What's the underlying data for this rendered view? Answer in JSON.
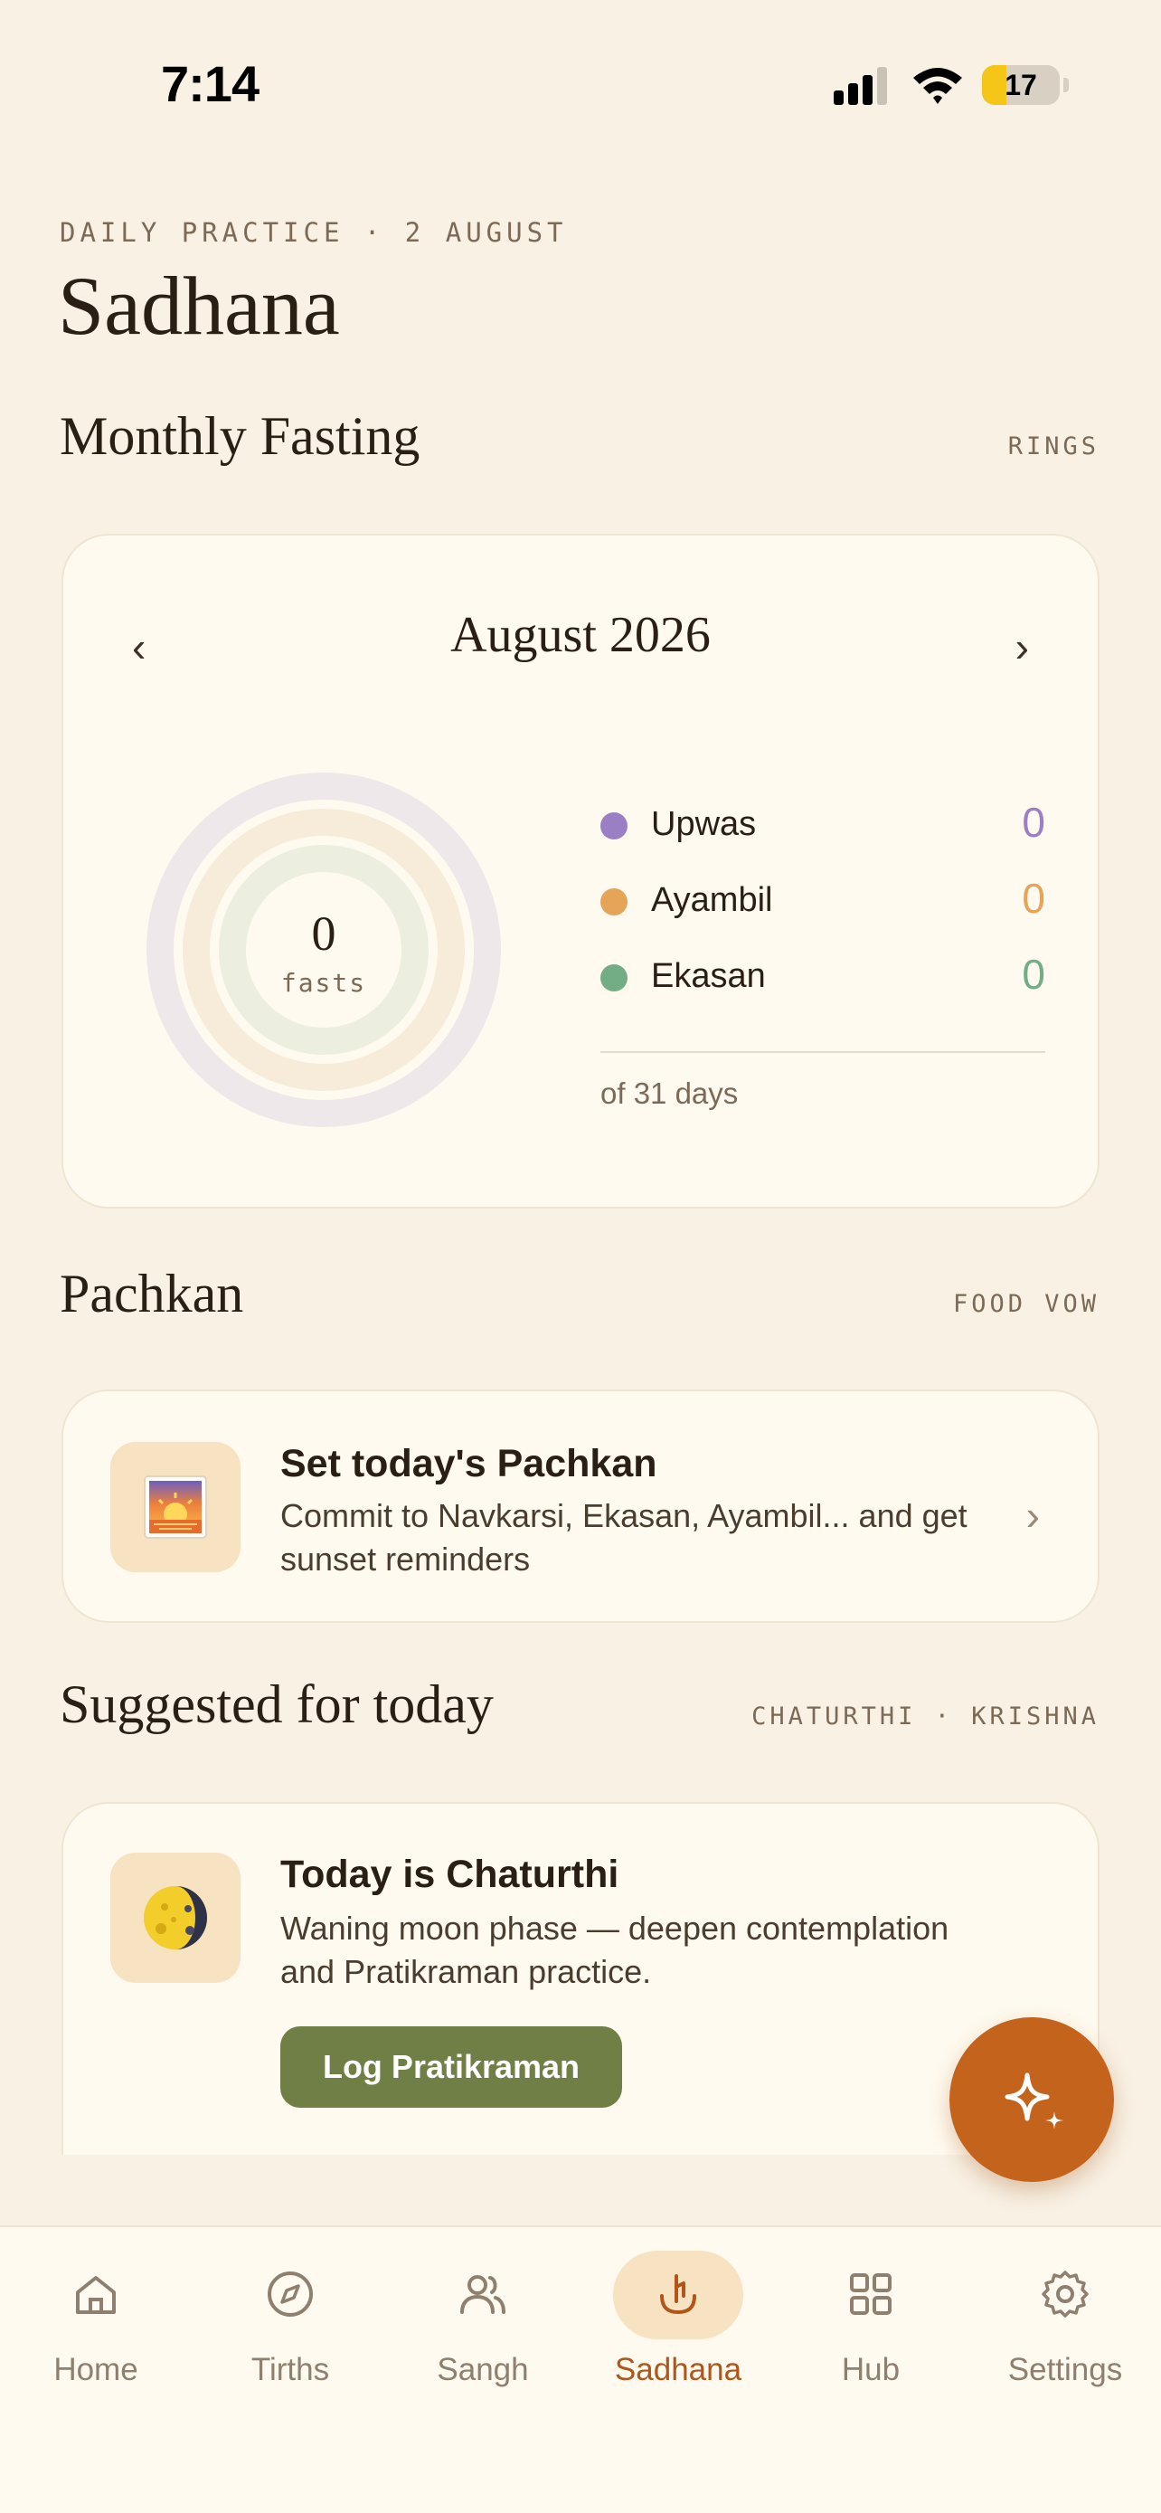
{
  "status_bar": {
    "time": "7:14",
    "battery_level": 17,
    "battery_fraction": 0.17
  },
  "header": {
    "eyebrow": "DAILY PRACTICE · 2 AUGUST",
    "title": "Sadhana"
  },
  "monthly_fasting": {
    "title": "Monthly Fasting",
    "tag": "RINGS",
    "month_label": "August 2026",
    "prev_icon": "chevron-left-icon",
    "next_icon": "chevron-right-icon",
    "prev_glyph": "‹",
    "next_glyph": "›",
    "total_count": "0",
    "total_unit": "fasts",
    "legend": [
      {
        "label": "Upwas",
        "count": "0",
        "color": "#9b7fc4",
        "ring_color": "#efe8ea"
      },
      {
        "label": "Ayambil",
        "count": "0",
        "color": "#e5a458",
        "ring_color": "#f7ecda"
      },
      {
        "label": "Ekasan",
        "count": "0",
        "color": "#72ad86",
        "ring_color": "#ecefe0"
      }
    ],
    "of_days": "of 31 days"
  },
  "pachkan": {
    "title": "Pachkan",
    "tag": "FOOD VOW",
    "card_title": "Set today's Pachkan",
    "card_body": "Commit to Navkarsi, Ekasan, Ayambil... and get sunset reminders",
    "icon": "sunset-icon",
    "chevron_glyph": "›"
  },
  "suggested": {
    "title": "Suggested for today",
    "tag": "CHATURTHI · KRISHNA",
    "card_title": "Today is Chaturthi",
    "card_body": "Waning moon phase — deepen contemplation and Pratikraman practice.",
    "icon": "moon-icon",
    "button_label": "Log Pratikraman"
  },
  "fab": {
    "icon": "sparkle-icon"
  },
  "tabs": [
    {
      "label": "Home",
      "icon": "home-icon",
      "active": false
    },
    {
      "label": "Tirths",
      "icon": "compass-icon",
      "active": false
    },
    {
      "label": "Sangh",
      "icon": "users-icon",
      "active": false
    },
    {
      "label": "Sadhana",
      "icon": "sadhana-icon",
      "active": true
    },
    {
      "label": "Hub",
      "icon": "grid-icon",
      "active": false
    },
    {
      "label": "Settings",
      "icon": "gear-icon",
      "active": false
    }
  ],
  "colors": {
    "accent": "#c4631b",
    "active_tab": "#b0561a",
    "button": "#6f7f45",
    "background": "#f8f1e4"
  }
}
